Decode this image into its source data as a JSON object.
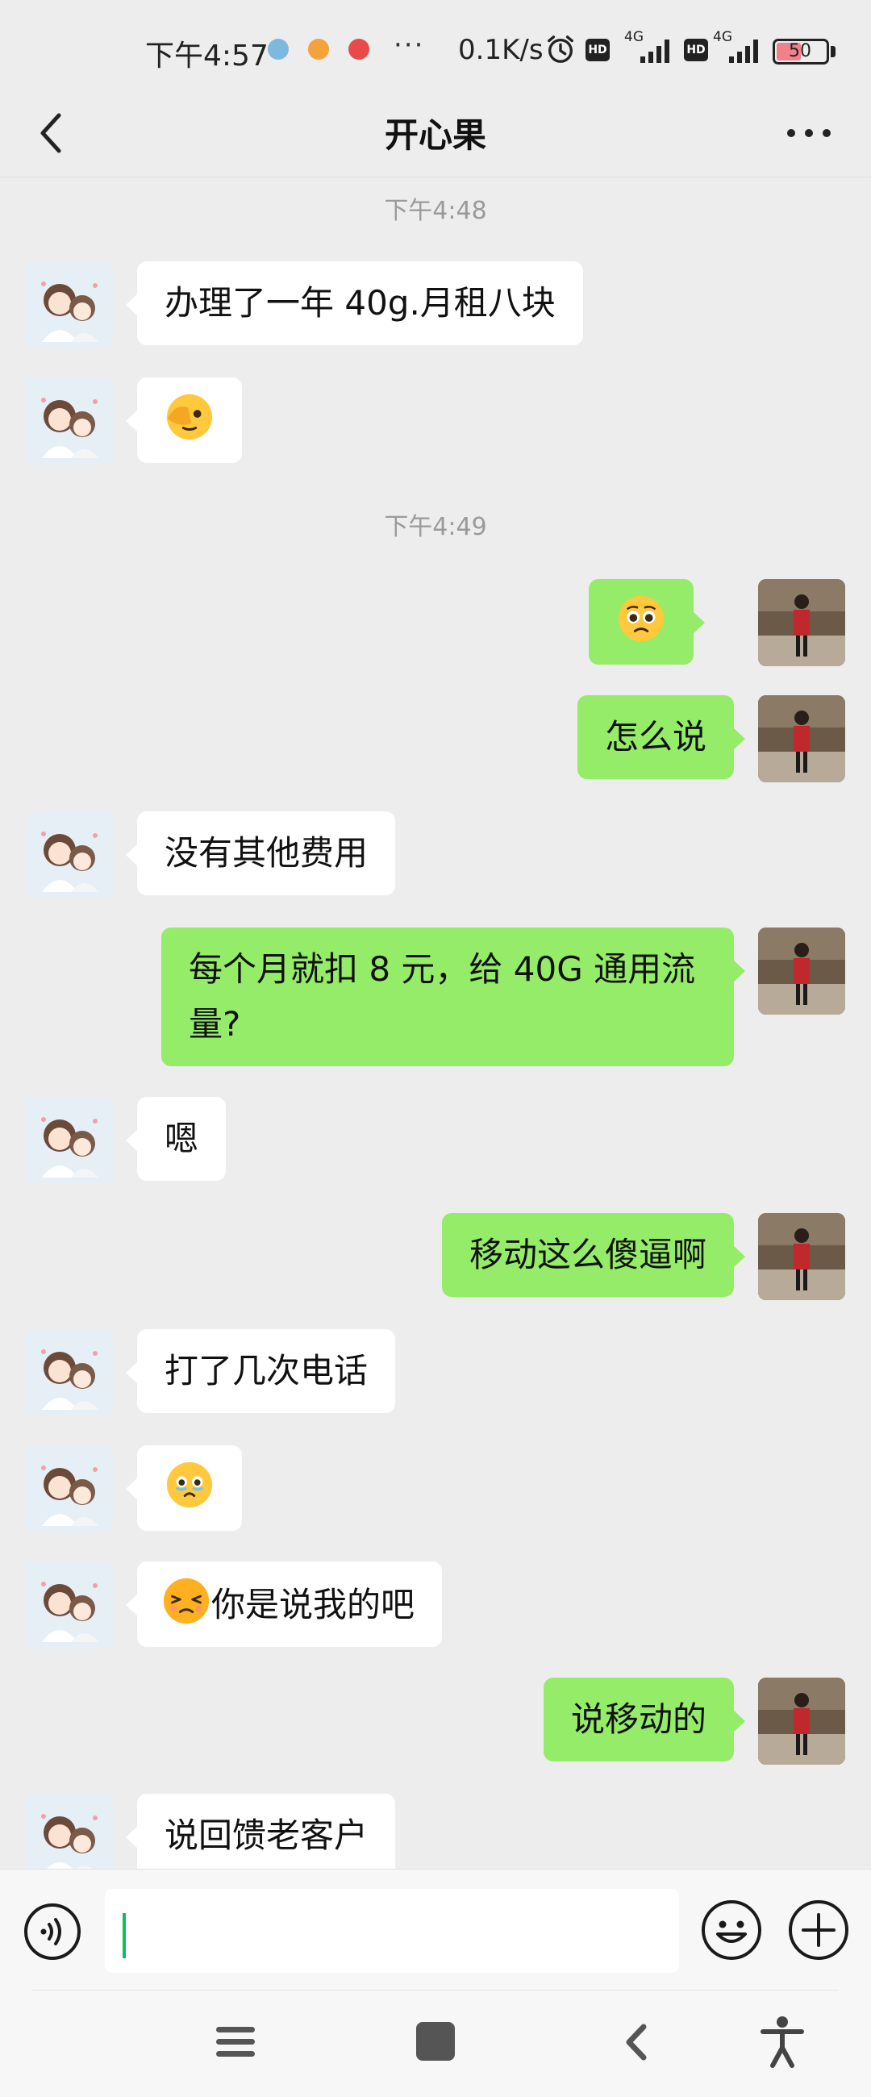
{
  "status_bar": {
    "time": "下午4:57",
    "net_speed": "0.1K/s",
    "hd1": "HD",
    "net1": "4G",
    "hd2": "HD",
    "net2": "4G",
    "battery": "50",
    "battery_level": 0.5
  },
  "header": {
    "title": "开心果"
  },
  "messages": [
    {
      "type": "timestamp",
      "text": "下午4:48"
    },
    {
      "side": "left",
      "text": "办理了一年 40g.月租八块"
    },
    {
      "side": "left",
      "emoji": "face-with-hand-over-eye"
    },
    {
      "type": "timestamp",
      "text": "下午4:49"
    },
    {
      "side": "right",
      "emoji": "pleading-face"
    },
    {
      "side": "right",
      "text": "怎么说"
    },
    {
      "side": "left",
      "text": "没有其他费用"
    },
    {
      "side": "right",
      "text": "每个月就扣 8 元，给 40G 通用流量?"
    },
    {
      "side": "left",
      "text": "嗯"
    },
    {
      "side": "right",
      "text": "移动这么傻逼啊"
    },
    {
      "side": "left",
      "text": "打了几次电话"
    },
    {
      "side": "left",
      "emoji": "face-holding-back-tears"
    },
    {
      "side": "left",
      "emoji": "persevering-face",
      "text": "你是说我的吧"
    },
    {
      "side": "right",
      "text": "说移动的"
    },
    {
      "side": "left",
      "text": "说回馈老客户"
    }
  ],
  "colors": {
    "background": "#ededed",
    "bubble_self": "#95ec69",
    "bubble_other": "#ffffff",
    "cursor": "#07c160"
  }
}
